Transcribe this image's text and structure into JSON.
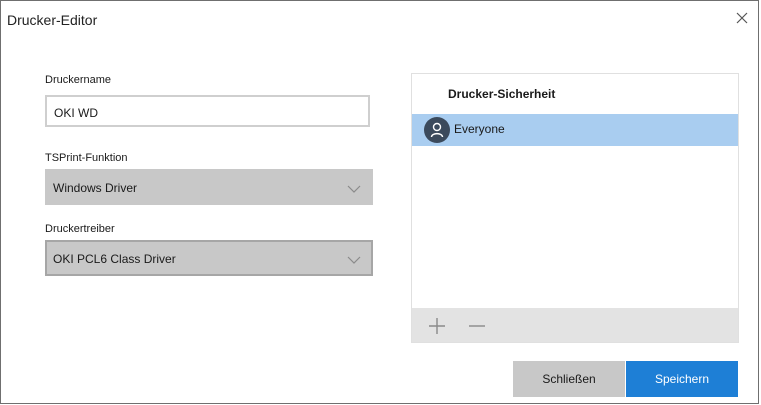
{
  "window": {
    "title": "Drucker-Editor"
  },
  "form": {
    "printer_name_label": "Druckername",
    "printer_name_value": "OKI WD",
    "function_label": "TSPrint-Funktion",
    "function_value": "Windows Driver",
    "driver_label": "Druckertreiber",
    "driver_value": "OKI PCL6 Class Driver"
  },
  "security": {
    "title": "Drucker-Sicherheit",
    "entries": [
      {
        "name": "Everyone",
        "icon": "user-icon",
        "selected": true
      }
    ],
    "add_icon": "plus-icon",
    "remove_icon": "minus-icon"
  },
  "buttons": {
    "close_label": "Schließen",
    "save_label": "Speichern"
  },
  "colors": {
    "accent": "#1e7fd6",
    "selection": "#a9cdf0",
    "disabled_field": "#c8c8c8"
  }
}
